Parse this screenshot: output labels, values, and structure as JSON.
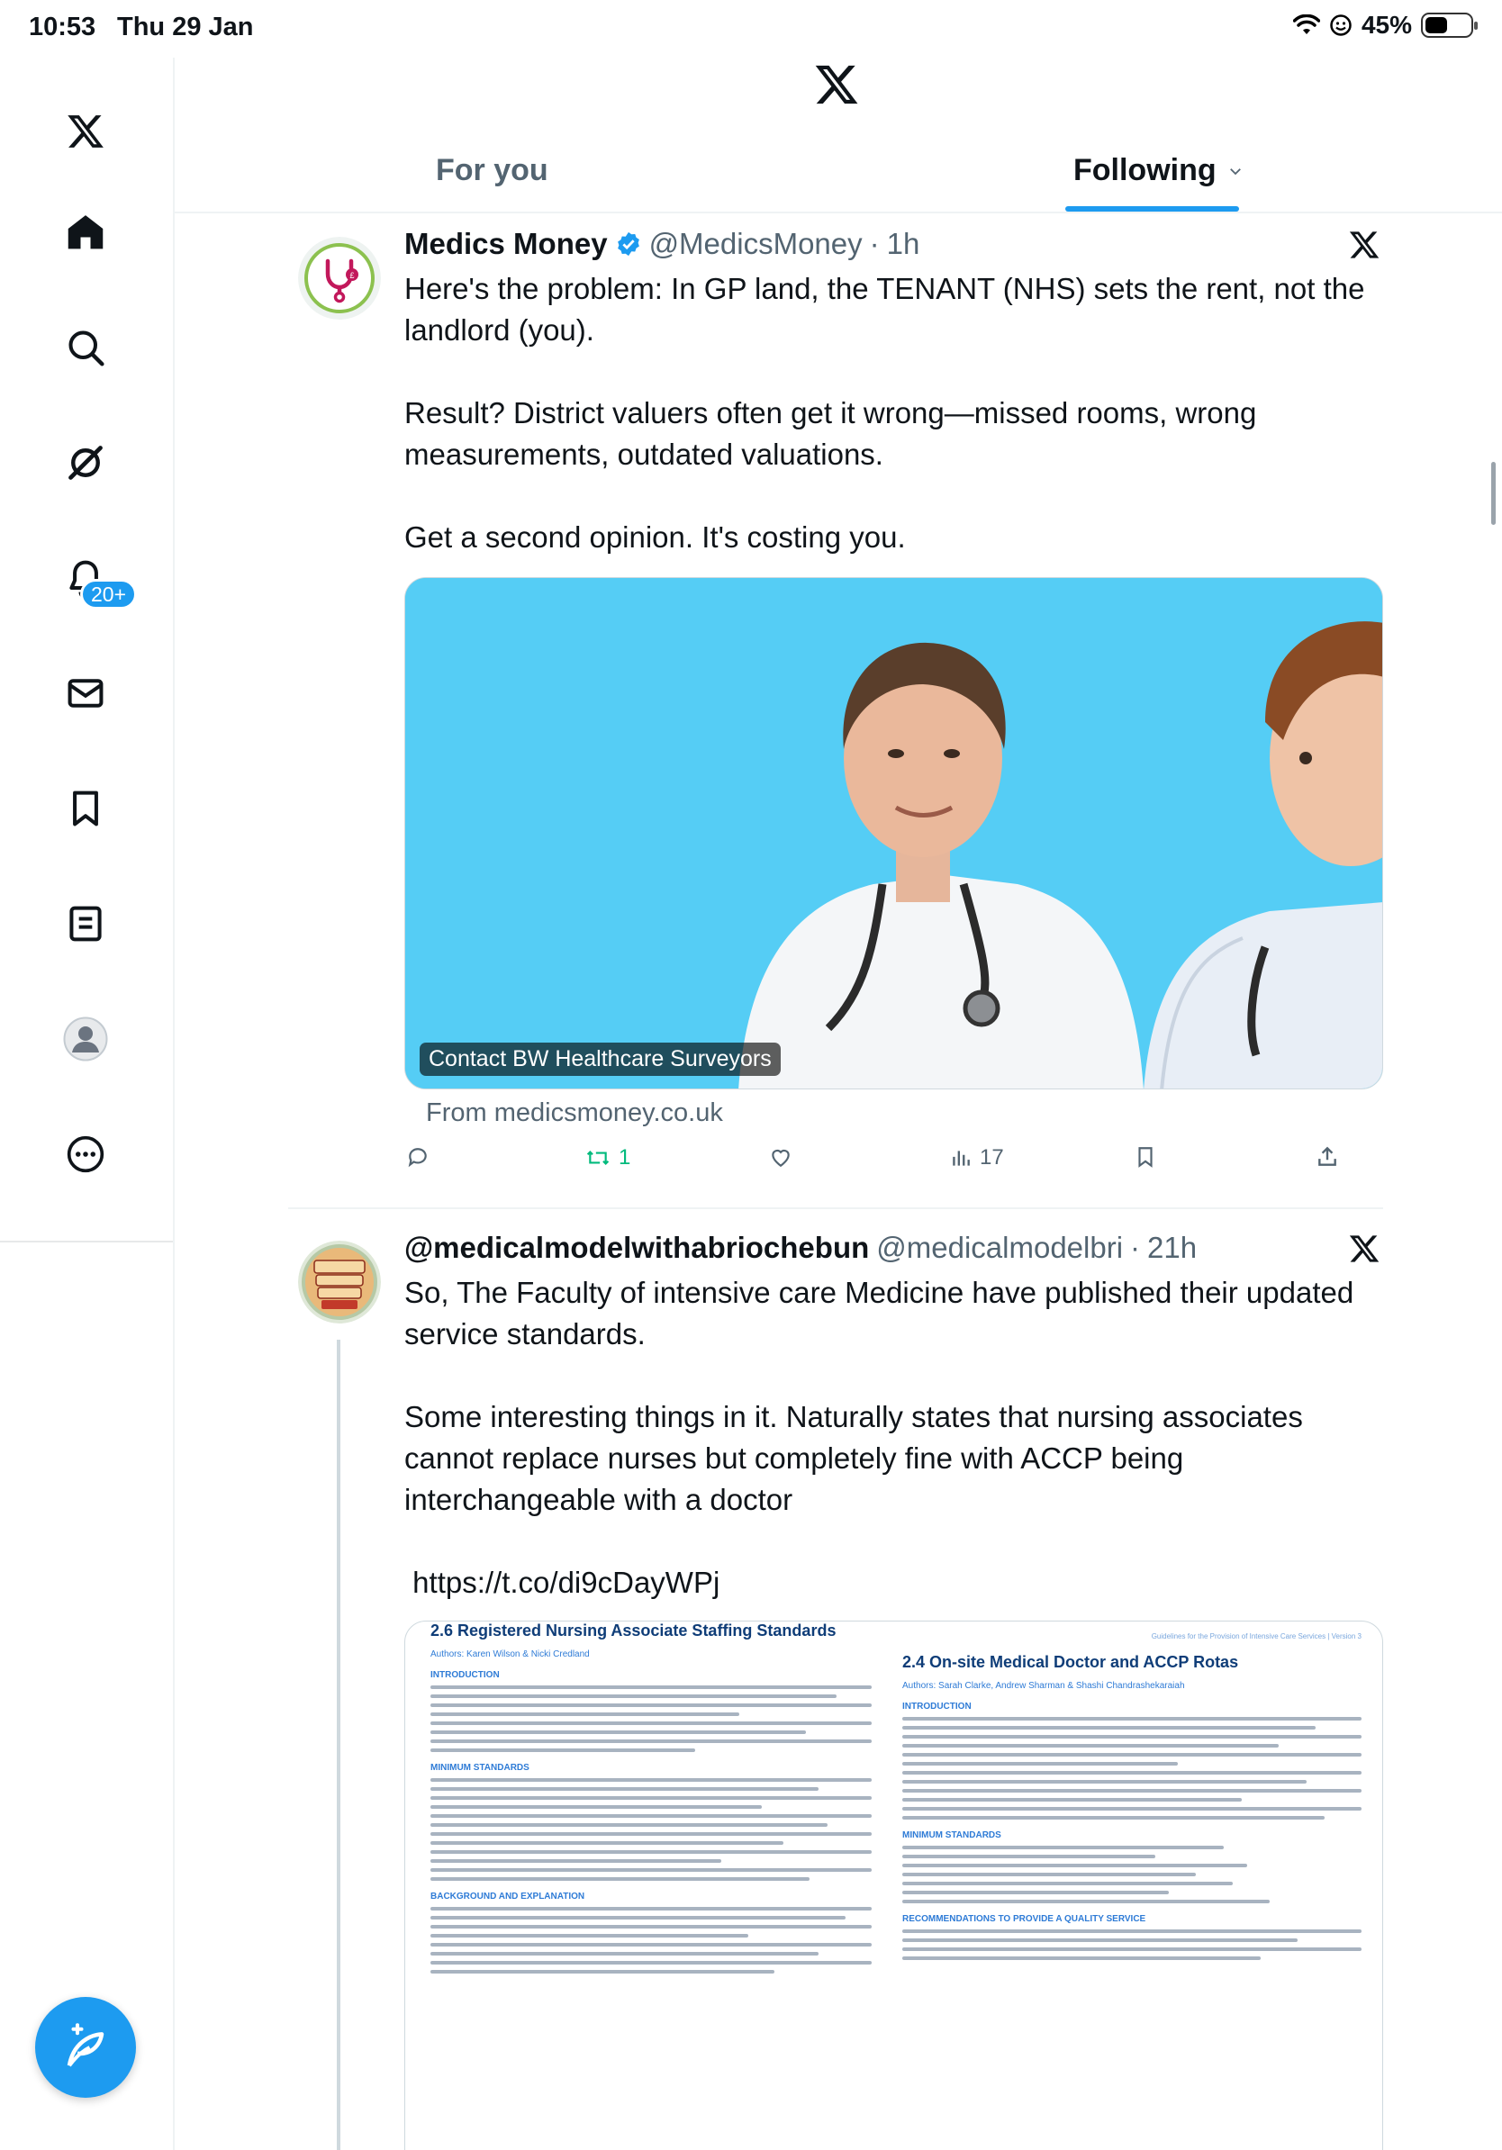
{
  "status_bar": {
    "time": "10:53",
    "date": "Thu 29 Jan",
    "battery": "45%",
    "battery_level": 0.45
  },
  "sidebar": {
    "items": [
      {
        "icon": "x-logo-icon"
      },
      {
        "icon": "home-icon"
      },
      {
        "icon": "search-icon"
      },
      {
        "icon": "grok-icon"
      },
      {
        "icon": "bell-icon",
        "badge": "20+"
      },
      {
        "icon": "mail-icon"
      },
      {
        "icon": "bookmark-icon"
      },
      {
        "icon": "list-icon"
      },
      {
        "icon": "profile-icon"
      },
      {
        "icon": "more-icon"
      }
    ]
  },
  "tabs": {
    "for_you": "For you",
    "following": "Following"
  },
  "posts": [
    {
      "author": "Medics Money",
      "verified": true,
      "handle": "@MedicsMoney",
      "time": "1h",
      "text": [
        "Here's the problem: In GP land, the TENANT (NHS) sets the rent, not the landlord (you).",
        "Result? District valuers often get it wrong—missed rooms, wrong measurements, outdated valuations.",
        "Get a second opinion. It's costing you."
      ],
      "card": {
        "label": "Contact BW Healthcare Surveyors",
        "from": "From medicsmoney.co.uk"
      },
      "actions": {
        "retweets": "1",
        "views": "17"
      }
    },
    {
      "author": "@medicalmodelwithabriochebun",
      "handle": "@medicalmodelbri",
      "time": "21h",
      "text": [
        "So, The Faculty of intensive care Medicine have published their updated service standards.",
        "Some interesting things in it. Naturally states that nursing associates cannot replace nurses but completely fine with ACCP being interchangeable with a doctor",
        " https://t.co/di9cDayWPj"
      ],
      "document": {
        "left_title": "2.6 Registered Nursing Associate Staffing Standards",
        "left_authors": "Authors: Karen Wilson & Nicki Credland",
        "left_headings": [
          "INTRODUCTION",
          "MINIMUM STANDARDS",
          "BACKGROUND AND EXPLANATION"
        ],
        "right_header": "Guidelines for the Provision of Intensive Care Services | Version 3",
        "right_title": "2.4 On-site Medical Doctor and ACCP Rotas",
        "right_authors": "Authors: Sarah Clarke, Andrew Sharman & Shashi Chandrashekaraiah",
        "right_headings": [
          "INTRODUCTION",
          "MINIMUM STANDARDS",
          "RECOMMENDATIONS TO PROVIDE A QUALITY SERVICE"
        ]
      }
    }
  ]
}
